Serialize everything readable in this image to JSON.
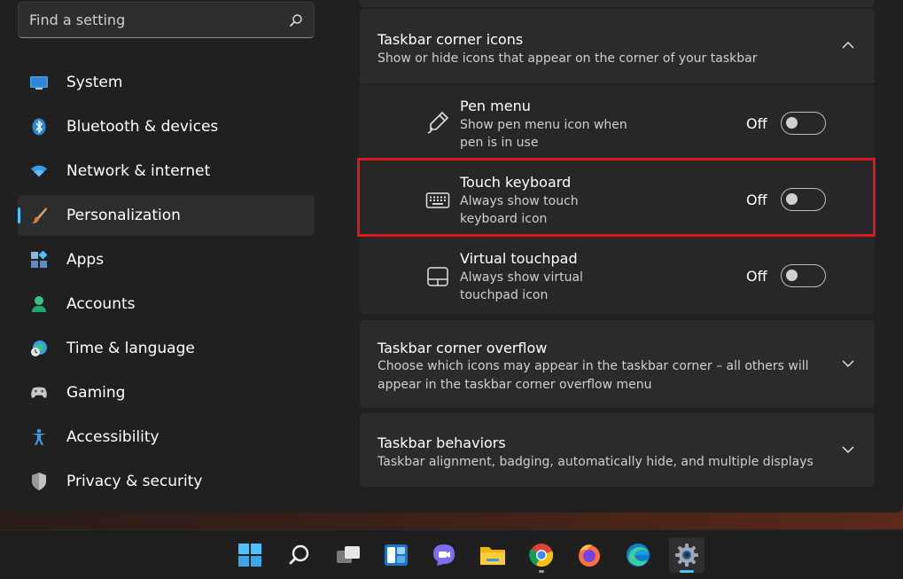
{
  "search": {
    "placeholder": "Find a setting"
  },
  "sidebar": {
    "items": [
      {
        "label": "System",
        "icon": "monitor-icon"
      },
      {
        "label": "Bluetooth & devices",
        "icon": "bluetooth-icon"
      },
      {
        "label": "Network & internet",
        "icon": "wifi-icon"
      },
      {
        "label": "Personalization",
        "icon": "brush-icon",
        "active": true
      },
      {
        "label": "Apps",
        "icon": "apps-icon"
      },
      {
        "label": "Accounts",
        "icon": "person-icon"
      },
      {
        "label": "Time & language",
        "icon": "globe-clock-icon"
      },
      {
        "label": "Gaming",
        "icon": "gamepad-icon"
      },
      {
        "label": "Accessibility",
        "icon": "accessibility-icon"
      },
      {
        "label": "Privacy & security",
        "icon": "shield-icon"
      }
    ]
  },
  "sections": {
    "corner_icons": {
      "title": "Taskbar corner icons",
      "subtitle": "Show or hide icons that appear on the corner of your taskbar",
      "expanded": true,
      "items": [
        {
          "title": "Pen menu",
          "desc1": "Show pen menu icon when",
          "desc2": "pen is in use",
          "state": "Off",
          "icon": "pen-icon"
        },
        {
          "title": "Touch keyboard",
          "desc1": "Always show touch",
          "desc2": "keyboard icon",
          "state": "Off",
          "icon": "keyboard-icon",
          "highlighted": true
        },
        {
          "title": "Virtual touchpad",
          "desc1": "Always show virtual",
          "desc2": "touchpad icon",
          "state": "Off",
          "icon": "touchpad-icon"
        }
      ]
    },
    "corner_overflow": {
      "title": "Taskbar corner overflow",
      "subtitle1": "Choose which icons may appear in the taskbar corner – all others will",
      "subtitle2": "appear in the taskbar corner overflow menu"
    },
    "behaviors": {
      "title": "Taskbar behaviors",
      "subtitle": "Taskbar alignment, badging, automatically hide, and multiple displays"
    }
  },
  "colors": {
    "accent": "#4cc2ff",
    "highlight_box": "#e0161e"
  },
  "taskbar": {
    "apps": [
      "start-icon",
      "search-icon",
      "task-view-icon",
      "widgets-icon",
      "chat-icon",
      "file-explorer-icon",
      "chrome-icon",
      "firefox-icon",
      "edge-icon",
      "settings-icon"
    ]
  }
}
